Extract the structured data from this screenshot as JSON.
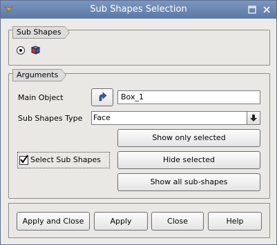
{
  "window": {
    "title": "Sub Shapes Selection"
  },
  "sub_shapes_group": {
    "title": "Sub Shapes"
  },
  "arguments_group": {
    "title": "Arguments",
    "main_object_label": "Main Object",
    "main_object_value": "Box_1",
    "sub_shapes_type_label": "Sub Shapes Type",
    "sub_shapes_type_value": "Face",
    "select_sub_shapes_label": "Select Sub Shapes",
    "show_only_selected_label": "Show only selected",
    "hide_selected_label": "Hide selected",
    "show_all_label": "Show all sub-shapes"
  },
  "buttons": {
    "apply_and_close": "Apply and Close",
    "apply": "Apply",
    "close": "Close",
    "help": "Help"
  },
  "icons": [
    "app-icon",
    "maximize-icon",
    "close-icon",
    "box-shape-icon",
    "select-arrow-icon",
    "dropdown-arrow-icon",
    "checkmark-icon"
  ]
}
